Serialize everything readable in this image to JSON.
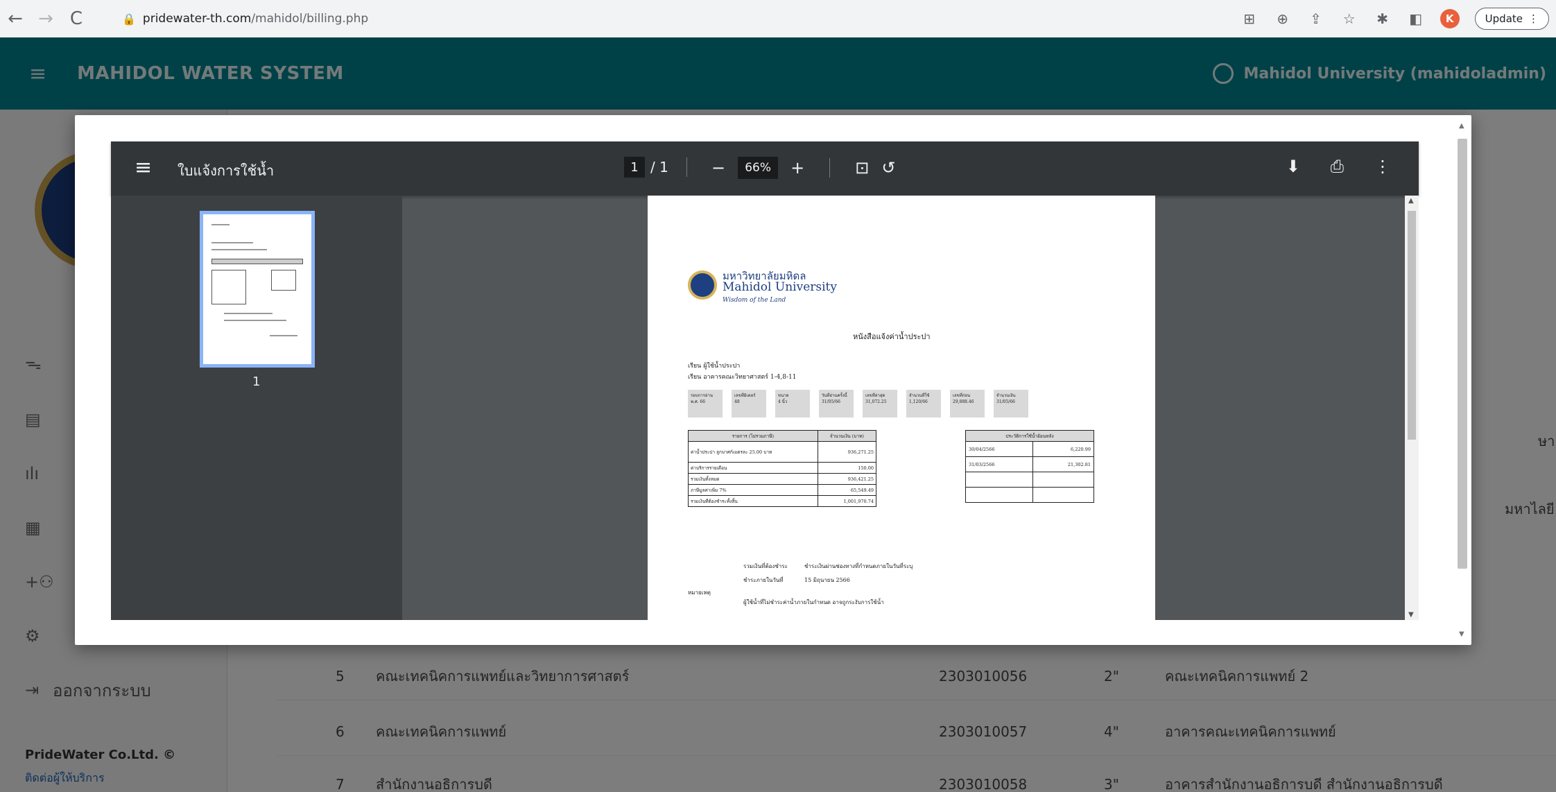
{
  "browser": {
    "url_host": "pridewater-th.com",
    "url_path": "/mahidol/billing.php",
    "update_label": "Update",
    "avatar_letter": "K"
  },
  "app": {
    "title": "MAHIDOL WATER SYSTEM",
    "user": "Mahidol University (mahidoladmin)"
  },
  "sidebar": {
    "logout_label": "ออกจากระบบ",
    "footer": "PrideWater Co.Ltd. ©",
    "footer_link": "ติดต่อผู้ให้บริการ"
  },
  "background_table": {
    "rows": [
      {
        "no": "5",
        "name": "คณะเทคนิคการแพทย์และวิทยาการศาสตร์",
        "meter": "2303010056",
        "size": "2\"",
        "location": "คณะเทคนิคการแพทย์ 2"
      },
      {
        "no": "6",
        "name": "คณะเทคนิคการแพทย์",
        "meter": "2303010057",
        "size": "4\"",
        "location": "อาคารคณะเทคนิคการแพทย์"
      },
      {
        "no": "7",
        "name": "สำนักงานอธิการบดี",
        "meter": "2303010058",
        "size": "3\"",
        "location": "อาคารสำนักงานอธิการบดี สำนักงานอธิการบดี"
      }
    ],
    "right_frag_1": "ษา",
    "right_frag_2": "มหาไลยี"
  },
  "pdf_viewer": {
    "title": "ใบแจ้งการใช้น้ำ",
    "page_current": "1",
    "page_total": "/ 1",
    "zoom": "66%",
    "thumbnail_label": "1"
  },
  "pdf_document": {
    "logo_th": "มหาวิทยาลัยมหิดล",
    "logo_en": "Mahidol University",
    "logo_motto": "Wisdom of the Land",
    "doc_title": "หนังสือแจ้งค่าน้ำประปา",
    "info_line_1": "เรียน ผู้ใช้น้ำประปา",
    "info_line_2": "เรียน อาคารคณะวิทยาศาสตร์ 1-4,8-11",
    "info_cells": [
      "รอบการอ่าน\nพ.ศ. 66",
      "เลขที่มิเตอร์\n48",
      "ขนาด\n4 นิ้ว",
      "วันที่อ่านครั้งนี้\n31/05/66",
      "เลขที่ล่าสุด\n31,072.25",
      "จำนวนที่ใช้\n1,120/66",
      "เลขที่ก่อน\n29,888.46",
      "จำนวนเงิน\n31/05/66"
    ],
    "bill_table": {
      "headers": [
        "รายการ (ไม่รวมภาษี)",
        "จำนวนเงิน (บาท)"
      ],
      "rows": [
        [
          "ค่าน้ำประปา ลูกบาศก์เมตรละ 25.00 บาท",
          "936,271.25"
        ],
        [
          "ค่าบริการรายเดือน",
          "150.00"
        ],
        [
          "รวมเงินทั้งหมด",
          "936,421.25"
        ],
        [
          "ภาษีมูลค่าเพิ่ม 7%",
          "65,549.49"
        ],
        [
          "รวมเงินที่ต้องชำระทั้งสิ้น",
          "1,001,970.74"
        ]
      ]
    },
    "read_table": {
      "header": "ประวัติการใช้น้ำย้อนหลัง",
      "rows": [
        [
          "30/04/2566",
          "6,220.99"
        ],
        [
          "31/03/2566",
          "21,302.81"
        ],
        [
          "",
          ""
        ],
        [
          "",
          ""
        ]
      ]
    },
    "pay_label_1": "รวมเงินที่ต้องชำระ",
    "pay_value_1": "ชำระเงินผ่านช่องทางที่กำหนดภายในวันที่ระบุ",
    "pay_label_2": "ชำระภายในวันที่",
    "pay_value_2": "15 มิถุนายน 2566",
    "note_label": "หมายเหตุ",
    "note_text": "ผู้ใช้น้ำที่ไม่ชำระค่าน้ำภายในกำหนด อาจถูกระงับการใช้น้ำ"
  }
}
